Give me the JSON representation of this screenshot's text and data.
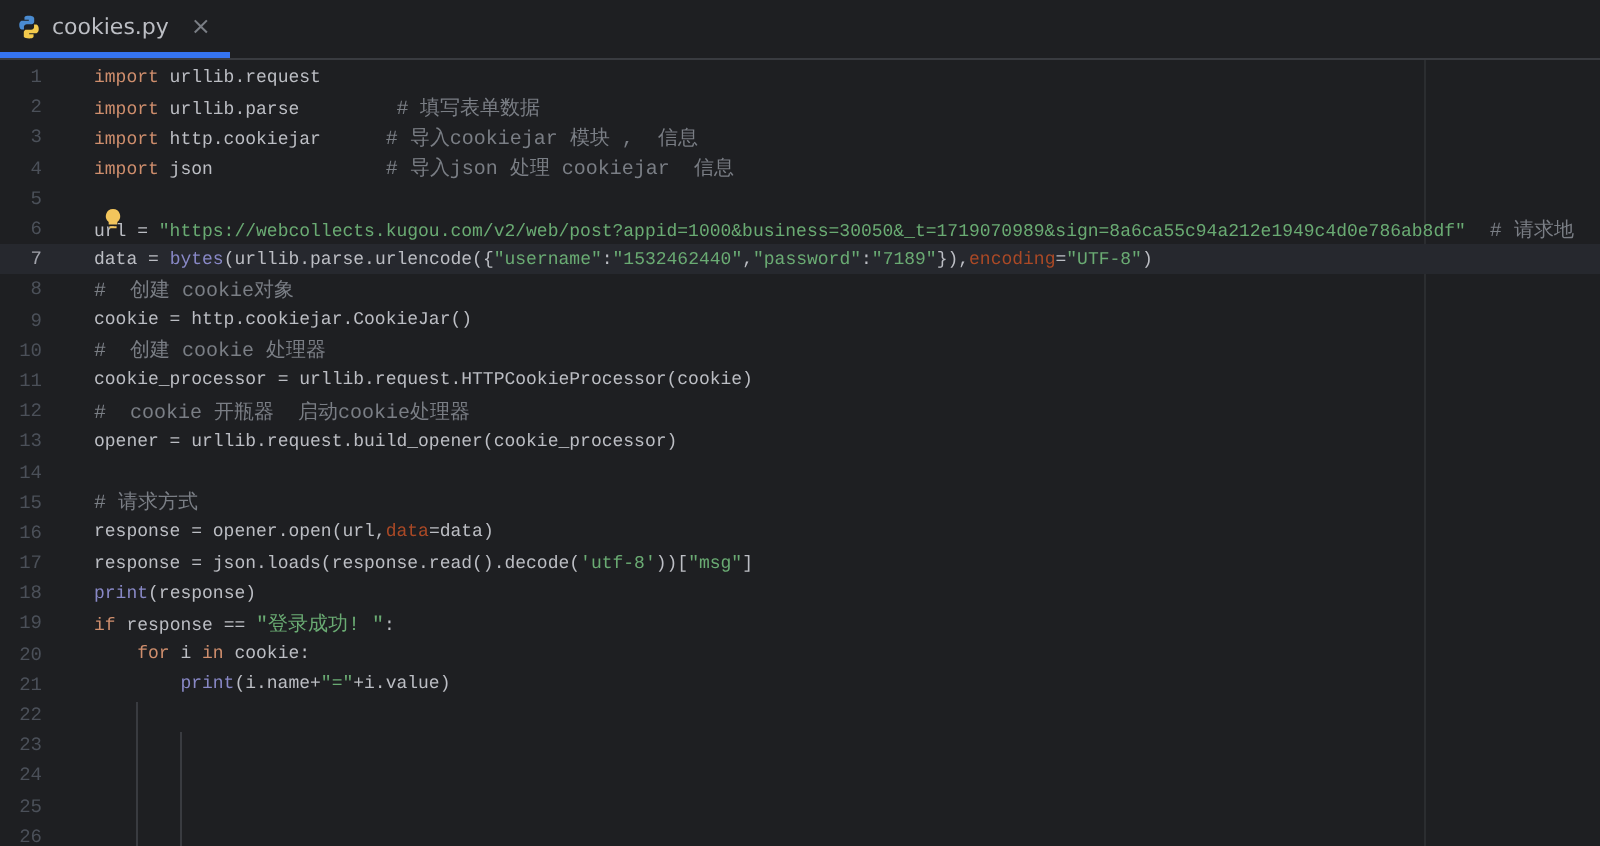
{
  "tab": {
    "label": "cookies.py",
    "selected": true,
    "close": "×"
  },
  "lines": [
    {
      "number": "1",
      "current": false,
      "tokens": [
        {
          "kind": "keyword",
          "text": "import"
        },
        {
          "kind": "plain",
          "text": " urllib.request"
        }
      ]
    },
    {
      "number": "2",
      "current": false,
      "tokens": [
        {
          "kind": "keyword",
          "text": "import"
        },
        {
          "kind": "plain",
          "text": " urllib.parse         "
        },
        {
          "kind": "comment",
          "text": "# 填写表单数据"
        }
      ]
    },
    {
      "number": "3",
      "current": false,
      "tokens": [
        {
          "kind": "keyword",
          "text": "import"
        },
        {
          "kind": "plain",
          "text": " http.cookiejar      "
        },
        {
          "kind": "comment",
          "text": "# 导入cookiejar 模块 ,  信息"
        }
      ]
    },
    {
      "number": "4",
      "current": false,
      "tokens": [
        {
          "kind": "keyword",
          "text": "import"
        },
        {
          "kind": "plain",
          "text": " json                "
        },
        {
          "kind": "comment",
          "text": "# 导入json 处理 cookiejar  信息"
        }
      ]
    },
    {
      "number": "5",
      "current": false
    },
    {
      "number": "6",
      "current": false,
      "tokens": [
        {
          "kind": "plain",
          "text": "url = "
        },
        {
          "kind": "string",
          "text": "\"https://webcollects.kugou.com/v2/web/post?appid=1000&business=30050&_t=1719070989&sign=8a6ca55c94a212e1949c4d0e786ab8df\""
        },
        {
          "kind": "comment",
          "text": "  # 请求地"
        }
      ]
    },
    {
      "number": "7",
      "current": true,
      "tokens": [
        {
          "kind": "plain",
          "text": "data = "
        },
        {
          "kind": "builtin",
          "text": "bytes"
        },
        {
          "kind": "plain",
          "text": "(urllib.parse.urlencode({"
        },
        {
          "kind": "string",
          "text": "\"username\""
        },
        {
          "kind": "plain",
          "text": ":"
        },
        {
          "kind": "string",
          "text": "\"1532462440\""
        },
        {
          "kind": "plain",
          "text": ","
        },
        {
          "kind": "string",
          "text": "\"password\""
        },
        {
          "kind": "plain",
          "text": ":"
        },
        {
          "kind": "string",
          "text": "\"7189\""
        },
        {
          "kind": "plain",
          "text": "}),"
        },
        {
          "kind": "param",
          "text": "encoding"
        },
        {
          "kind": "plain",
          "text": "="
        },
        {
          "kind": "string",
          "text": "\"UTF-8\""
        },
        {
          "kind": "plain",
          "text": ")"
        }
      ]
    },
    {
      "number": "8",
      "current": false,
      "tokens": [
        {
          "kind": "comment",
          "text": "#  创建 cookie对象"
        }
      ]
    },
    {
      "number": "9",
      "current": false,
      "tokens": [
        {
          "kind": "plain",
          "text": "cookie = http.cookiejar.CookieJar()"
        }
      ]
    },
    {
      "number": "10",
      "current": false,
      "tokens": [
        {
          "kind": "comment",
          "text": "#  创建 cookie 处理器"
        }
      ]
    },
    {
      "number": "11",
      "current": false,
      "tokens": [
        {
          "kind": "plain",
          "text": "cookie_processor = urllib.request.HTTPCookieProcessor(cookie)"
        }
      ]
    },
    {
      "number": "12",
      "current": false,
      "tokens": [
        {
          "kind": "comment",
          "text": "#  cookie 开瓶器  启动cookie处理器"
        }
      ]
    },
    {
      "number": "13",
      "current": false,
      "tokens": [
        {
          "kind": "plain",
          "text": "opener = urllib.request.build_opener(cookie_processor)"
        }
      ]
    },
    {
      "number": "14",
      "current": false
    },
    {
      "number": "15",
      "current": false,
      "tokens": [
        {
          "kind": "comment",
          "text": "# 请求方式"
        }
      ]
    },
    {
      "number": "16",
      "current": false,
      "tokens": [
        {
          "kind": "plain",
          "text": "response = opener.open(url,"
        },
        {
          "kind": "param",
          "text": "data"
        },
        {
          "kind": "plain",
          "text": "=data)"
        }
      ]
    },
    {
      "number": "17",
      "current": false,
      "tokens": [
        {
          "kind": "plain",
          "text": "response = json.loads(response.read().decode("
        },
        {
          "kind": "string",
          "text": "'utf-8'"
        },
        {
          "kind": "plain",
          "text": "))["
        },
        {
          "kind": "string",
          "text": "\"msg\""
        },
        {
          "kind": "plain",
          "text": "]"
        }
      ]
    },
    {
      "number": "18",
      "current": false,
      "tokens": [
        {
          "kind": "builtin",
          "text": "print"
        },
        {
          "kind": "plain",
          "text": "(response)"
        }
      ]
    },
    {
      "number": "19",
      "current": false,
      "tokens": [
        {
          "kind": "keyword",
          "text": "if"
        },
        {
          "kind": "plain",
          "text": " response == "
        },
        {
          "kind": "string",
          "text": "\"登录成功! \""
        },
        {
          "kind": "plain",
          "text": ":"
        }
      ],
      "children": [
        {
          "number": "20",
          "current": false,
          "tokens": [
            {
              "kind": "keyword",
              "text": "for"
            },
            {
              "kind": "plain",
              "text": " i "
            },
            {
              "kind": "keyword",
              "text": "in"
            },
            {
              "kind": "plain",
              "text": " cookie:"
            }
          ],
          "children": [
            {
              "number": "21",
              "current": false,
              "tokens": [
                {
                  "kind": "builtin",
                  "text": "print"
                },
                {
                  "kind": "plain",
                  "text": "(i.name+"
                },
                {
                  "kind": "string",
                  "text": "\"=\""
                },
                {
                  "kind": "plain",
                  "text": "+i.value)"
                }
              ]
            }
          ]
        }
      ]
    },
    {
      "number": "22",
      "current": false
    },
    {
      "number": "23",
      "current": false
    },
    {
      "number": "24",
      "current": false
    },
    {
      "number": "25",
      "current": false
    },
    {
      "number": "26",
      "current": false
    }
  ]
}
